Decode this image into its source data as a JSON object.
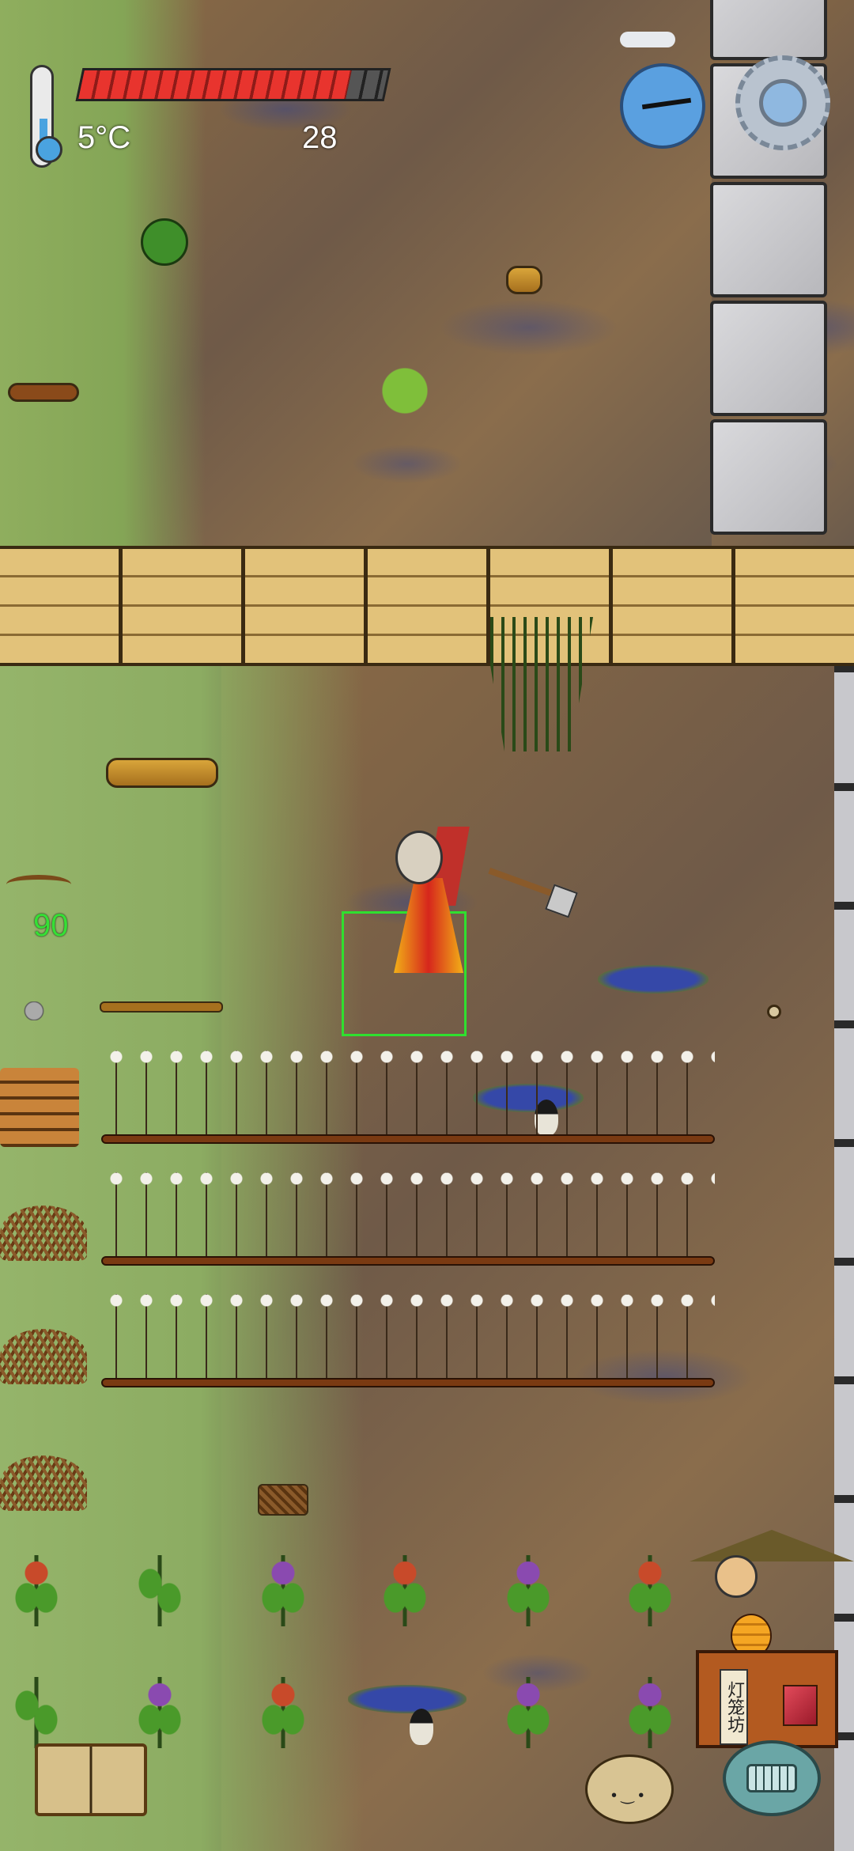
{
  "hud": {
    "temperature": "5°C",
    "health_fraction": 0.88,
    "food_value": "28",
    "compass_icon": "compass-icon",
    "settings_icon": "gear-icon"
  },
  "inventory": {
    "held_item_icon": "bow-icon",
    "held_item_count": "90"
  },
  "shop": {
    "sign_text": "灯笼坊"
  },
  "controls": {
    "journal_icon": "book-icon",
    "emote_icon": "potato-face-icon",
    "chat_icon": "keyboard-icon"
  },
  "colors": {
    "selection": "#2fe02f",
    "health": "#e8342e",
    "count_text": "#35e035"
  }
}
